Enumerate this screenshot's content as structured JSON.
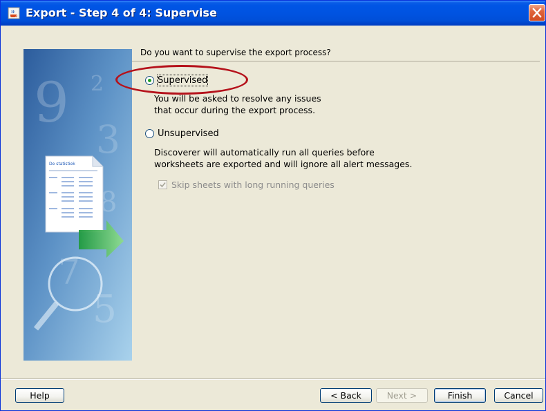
{
  "window": {
    "title": "Export - Step 4 of 4: Supervise"
  },
  "content": {
    "question": "Do you want to supervise the export process?",
    "supervised": {
      "label": "Supervised",
      "selected": true,
      "description_lines": [
        "You will be asked to resolve any issues",
        "that occur during the export process."
      ]
    },
    "unsupervised": {
      "label": "Unsupervised",
      "selected": false,
      "description_lines": [
        "Discoverer will automatically run all queries before",
        "worksheets are exported and will ignore all alert messages."
      ]
    },
    "skip_sheets": {
      "label": "Skip sheets with long running queries",
      "checked": true,
      "enabled": false
    }
  },
  "side_image": {
    "doc_heading": "De statistiek"
  },
  "buttons": {
    "help": "Help",
    "back": "< Back",
    "next": "Next >",
    "finish": "Finish",
    "cancel": "Cancel"
  },
  "colors": {
    "title_bar": "#0053e1",
    "annotation": "#b5121b",
    "selected_radio": "#21a121"
  },
  "icons": {
    "app": "java-cup-icon",
    "close": "close-icon"
  }
}
